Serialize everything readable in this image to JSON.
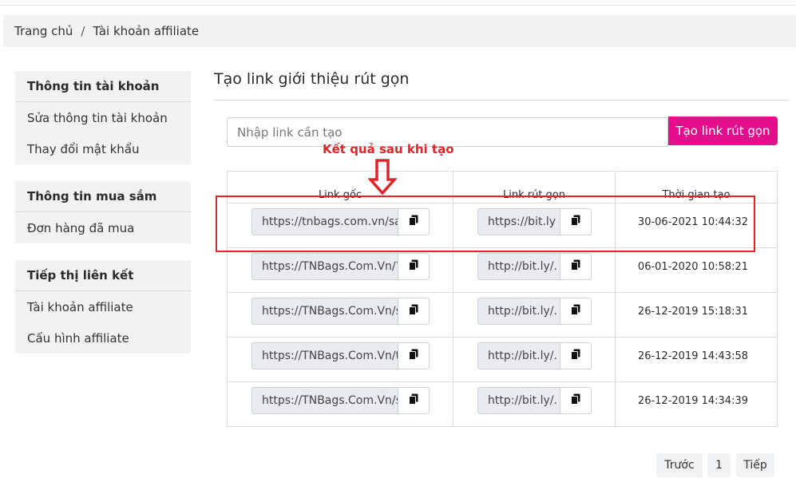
{
  "breadcrumb": {
    "home": "Trang chủ",
    "separator": "/",
    "current": "Tài khoản affiliate"
  },
  "sidebar": {
    "groups": [
      {
        "title": "Thông tin tài khoản",
        "items": [
          "Sửa thông tin tài khoản",
          "Thay đổi mật khẩu"
        ]
      },
      {
        "title": "Thông tin mua sắm",
        "items": [
          "Đơn hàng đã mua"
        ]
      },
      {
        "title": "Tiếp thị liên kết",
        "items": [
          "Tài khoản affiliate",
          "Cấu hình affiliate"
        ]
      }
    ]
  },
  "main": {
    "title": "Tạo link giới thiệu rút gọn",
    "input_placeholder": "Nhập link cần tạo",
    "create_button": "Tạo link rút gọn",
    "annotation": "Kết quả sau khi tạo",
    "table": {
      "headers": [
        "Link gốc",
        "Link rút gọn",
        "Thời gian tạo"
      ],
      "rows": [
        {
          "original": "https://tnbags.com.vn/sa",
          "short": "https://bit.ly",
          "time": "30-06-2021 10:44:32"
        },
        {
          "original": "https://TNBags.Com.Vn/?",
          "short": "http://bit.ly/.",
          "time": "06-01-2020 10:58:21"
        },
        {
          "original": "https://TNBags.Com.Vn/s",
          "short": "http://bit.ly/.",
          "time": "26-12-2019 15:18:31"
        },
        {
          "original": "https://TNBags.Com.Vn/t",
          "short": "http://bit.ly/.",
          "time": "26-12-2019 14:43:58"
        },
        {
          "original": "https://TNBags.Com.Vn/s",
          "short": "http://bit.ly/.",
          "time": "26-12-2019 14:34:39"
        }
      ]
    }
  },
  "pagination": {
    "prev": "Trước",
    "page": "1",
    "next": "Tiếp"
  },
  "colors": {
    "accent": "#e40e8c",
    "annotation": "#e0242a",
    "panel": "#f1f2f4"
  },
  "icons": {
    "copy": "copy-icon",
    "arrow": "down-arrow-icon"
  }
}
